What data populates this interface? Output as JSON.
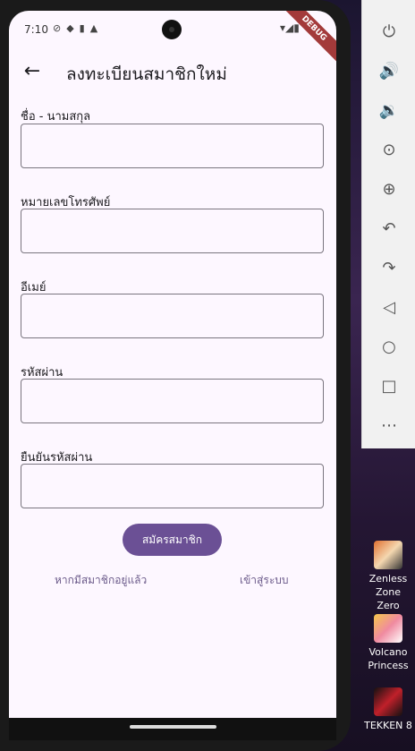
{
  "status_bar": {
    "time": "7:10",
    "debug_label": "DEBUG"
  },
  "app_bar": {
    "title": "ลงทะเบียนสมาชิกใหม่"
  },
  "form": {
    "fields": [
      {
        "label": "ชื่อ - นามสกุล",
        "value": ""
      },
      {
        "label": "หมายเลขโทรศัพย์",
        "value": ""
      },
      {
        "label": "อีเมย์",
        "value": ""
      },
      {
        "label": "รหัสผ่าน",
        "value": ""
      },
      {
        "label": "ยืนยันรหัสผ่าน",
        "value": ""
      }
    ],
    "submit_label": "สมัครสมาชิก",
    "already_member_text": "หากมีสมาชิกอยู่แล้ว",
    "login_link": "เข้าสู่ระบบ"
  },
  "emulator_toolbar": {
    "icons": [
      "power-icon",
      "volume-up-icon",
      "volume-down-icon",
      "camera-icon",
      "zoom-icon",
      "rotate-left-icon",
      "rotate-right-icon",
      "back-icon",
      "home-icon",
      "overview-icon",
      "more-icon"
    ]
  },
  "desktop_icons": [
    {
      "label_line1": "Zenless Zone",
      "label_line2": "Zero"
    },
    {
      "label_line1": "Volcano",
      "label_line2": "Princess"
    },
    {
      "label_line1": "TEKKEN 8",
      "label_line2": ""
    }
  ],
  "colors": {
    "primary": "#6b5095",
    "screen_bg": "#fdf7ff",
    "link": "#6b5a8a"
  }
}
